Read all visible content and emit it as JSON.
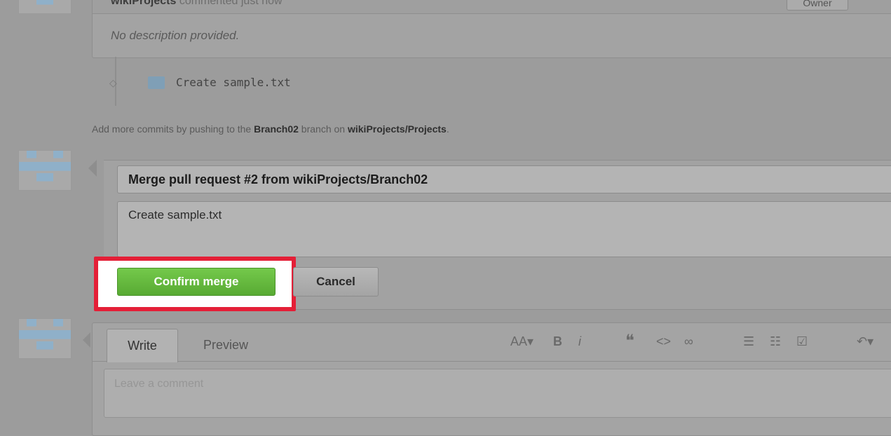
{
  "top_commit": {
    "author": "wikiProjects",
    "action": "commented just now",
    "badge": "Owner",
    "description": "No description provided."
  },
  "commit": {
    "message": "Create sample.txt"
  },
  "hint": {
    "prefix": "Add more commits by pushing to the ",
    "branch": "Branch02",
    "middle": " branch on ",
    "repo": "wikiProjects/Projects",
    "suffix": "."
  },
  "merge_form": {
    "title": "Merge pull request #2 from wikiProjects/Branch02",
    "body": "Create sample.txt",
    "confirm_label": "Confirm merge",
    "cancel_label": "Cancel"
  },
  "comment": {
    "tabs": [
      "Write",
      "Preview"
    ],
    "placeholder": "Leave a comment",
    "toolbar": {
      "header": "AA▾",
      "bold": "B",
      "italic": "i",
      "quote": "❝",
      "code": "<>",
      "link": "∞",
      "bulleted_list": "☰",
      "numbered_list": "☷",
      "task_list": "☑",
      "reply": "↶▾"
    }
  },
  "colors": {
    "highlight": "#e41f37",
    "confirm_button": "#63b83b"
  }
}
